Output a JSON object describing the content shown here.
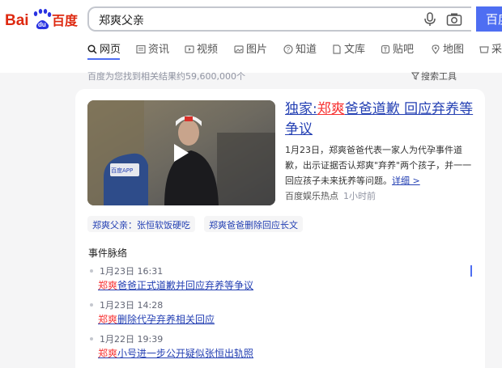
{
  "search": {
    "query": "郑爽父亲",
    "button_label": "百度"
  },
  "tabs": [
    {
      "label": "网页",
      "icon": "search-icon",
      "active": true
    },
    {
      "label": "资讯",
      "icon": "news-icon"
    },
    {
      "label": "视频",
      "icon": "video-icon"
    },
    {
      "label": "图片",
      "icon": "image-icon"
    },
    {
      "label": "知道",
      "icon": "question-icon"
    },
    {
      "label": "文库",
      "icon": "doc-icon"
    },
    {
      "label": "贴吧",
      "icon": "tieba-icon"
    },
    {
      "label": "地图",
      "icon": "map-icon"
    },
    {
      "label": "采购",
      "icon": "shop-icon"
    }
  ],
  "results_info": {
    "count_text": "百度为您找到相关结果约59,600,000个",
    "tools_label": "搜索工具"
  },
  "news_card": {
    "headline_prefix": "独家:",
    "headline_highlight": "郑爽",
    "headline_rest": "爸爸道歉 回应弃养等争议",
    "summary": "1月23日，郑爽爸爸代表一家人为代孕事件道歉，出示证据否认郑爽\"弃养\"两个孩子，并一一回应孩子未来抚养等问题。",
    "more_link": "详细 >",
    "source": "百度娱乐热点",
    "time_ago": "1小时前",
    "video_watermark": "百度APP"
  },
  "related_chips": [
    "郑爽父亲：张恒软饭硬吃",
    "郑爽爸爸删除回应长文"
  ],
  "timeline": {
    "title": "事件脉络",
    "events": [
      {
        "time": "1月23日 16:31",
        "highlight": "郑爽",
        "title": "爸爸正式道歉并回应弃养等争议"
      },
      {
        "time": "1月23日 14:28",
        "highlight": "郑爽",
        "title": "删除代孕弃养相关回应"
      },
      {
        "time": "1月22日 19:39",
        "highlight": "郑爽",
        "title": "小号进一步公开疑似张恒出轨照"
      }
    ]
  },
  "colors": {
    "brand_blue": "#4e6ef2",
    "link_blue": "#2440b3",
    "highlight_red": "#f73131"
  }
}
